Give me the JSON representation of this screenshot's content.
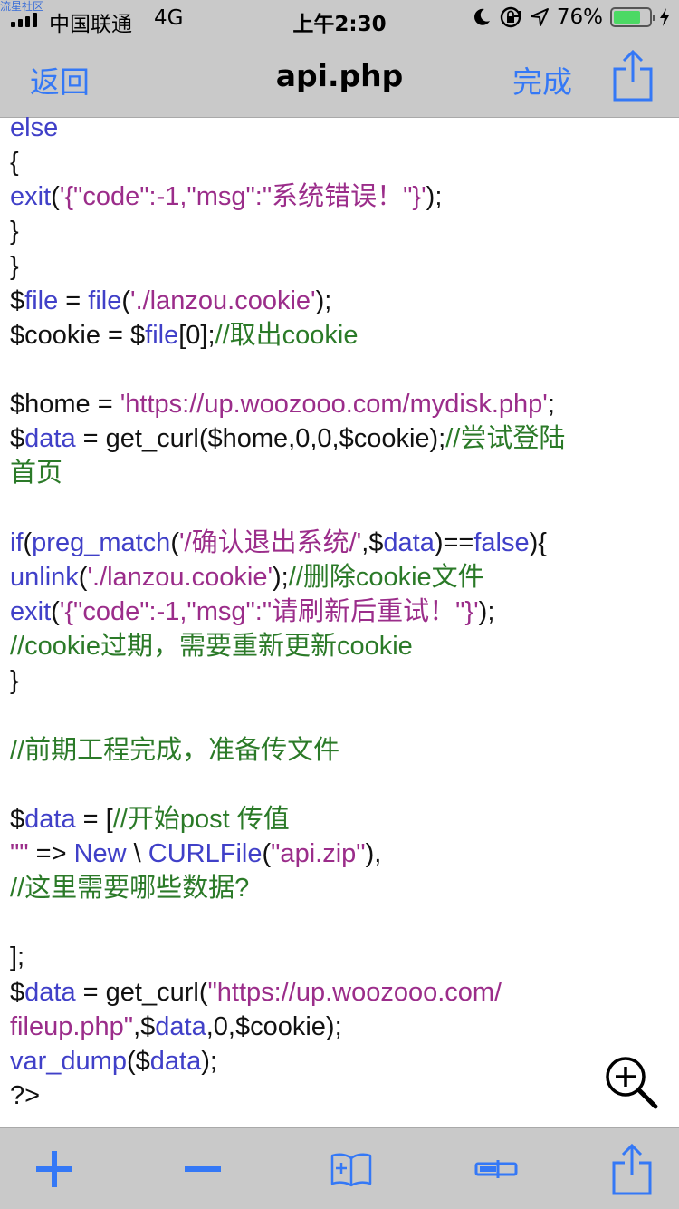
{
  "status_bar": {
    "watermark": "流星社区",
    "carrier": "中国联通",
    "network": "4G",
    "time": "上午2:30",
    "battery_percent": "76%",
    "battery_level": 0.76,
    "icons": [
      "moon-icon",
      "orientation-lock-icon",
      "location-arrow-icon",
      "battery-icon",
      "charging-bolt-icon"
    ]
  },
  "nav": {
    "back_label": "返回",
    "title": "api.php",
    "done_label": "完成",
    "share_icon": "share-icon"
  },
  "colors": {
    "keyword": "#4040c8",
    "string": "#9b2d8a",
    "comment": "#2b7a28",
    "accent": "#3478f6",
    "bar_bg": "#c9c9c9"
  },
  "code_lines": [
    [
      {
        "t": "else",
        "c": "kw"
      }
    ],
    [
      {
        "t": "{",
        "c": "pl"
      }
    ],
    [
      {
        "t": "exit",
        "c": "kw"
      },
      {
        "t": "(",
        "c": "pl"
      },
      {
        "t": "'{\"code\":-1,\"msg\":\"系统错误！\"}'",
        "c": "str"
      },
      {
        "t": ");",
        "c": "pl"
      }
    ],
    [
      {
        "t": "}",
        "c": "pl"
      }
    ],
    [
      {
        "t": "}",
        "c": "pl"
      }
    ],
    [
      {
        "t": "$",
        "c": "pl"
      },
      {
        "t": "file",
        "c": "kw"
      },
      {
        "t": " = ",
        "c": "pl"
      },
      {
        "t": "file",
        "c": "kw"
      },
      {
        "t": "(",
        "c": "pl"
      },
      {
        "t": "'./lanzou.cookie'",
        "c": "str"
      },
      {
        "t": ");",
        "c": "pl"
      }
    ],
    [
      {
        "t": "$cookie = $",
        "c": "pl"
      },
      {
        "t": "file",
        "c": "kw"
      },
      {
        "t": "[0];",
        "c": "pl"
      },
      {
        "t": "//取出cookie",
        "c": "cmt"
      }
    ],
    [],
    [
      {
        "t": "$home = ",
        "c": "pl"
      },
      {
        "t": "'https://up.woozooo.com/mydisk.php'",
        "c": "str"
      },
      {
        "t": ";",
        "c": "pl"
      }
    ],
    [
      {
        "t": "$",
        "c": "pl"
      },
      {
        "t": "data",
        "c": "kw"
      },
      {
        "t": " = get_curl($home,0,0,$cookie);",
        "c": "pl"
      },
      {
        "t": "//尝试登陆",
        "c": "cmt"
      }
    ],
    [
      {
        "t": "首页",
        "c": "cmt"
      }
    ],
    [],
    [
      {
        "t": "if",
        "c": "kw"
      },
      {
        "t": "(",
        "c": "pl"
      },
      {
        "t": "preg_match",
        "c": "kw"
      },
      {
        "t": "(",
        "c": "pl"
      },
      {
        "t": "'/确认退出系统/'",
        "c": "str"
      },
      {
        "t": ",$",
        "c": "pl"
      },
      {
        "t": "data",
        "c": "kw"
      },
      {
        "t": ")==",
        "c": "pl"
      },
      {
        "t": "false",
        "c": "kw"
      },
      {
        "t": "){",
        "c": "pl"
      }
    ],
    [
      {
        "t": "unlink",
        "c": "kw"
      },
      {
        "t": "(",
        "c": "pl"
      },
      {
        "t": "'./lanzou.cookie'",
        "c": "str"
      },
      {
        "t": ");",
        "c": "pl"
      },
      {
        "t": "//删除cookie文件",
        "c": "cmt"
      }
    ],
    [
      {
        "t": "exit",
        "c": "kw"
      },
      {
        "t": "(",
        "c": "pl"
      },
      {
        "t": "'{\"code\":-1,\"msg\":\"请刷新后重试！\"}'",
        "c": "str"
      },
      {
        "t": ");",
        "c": "pl"
      }
    ],
    [
      {
        "t": "//cookie过期，需要重新更新cookie",
        "c": "cmt"
      }
    ],
    [
      {
        "t": "}",
        "c": "pl"
      }
    ],
    [],
    [
      {
        "t": "//前期工程完成，准备传文件",
        "c": "cmt"
      }
    ],
    [],
    [
      {
        "t": "$",
        "c": "pl"
      },
      {
        "t": "data",
        "c": "kw"
      },
      {
        "t": " = [",
        "c": "pl"
      },
      {
        "t": "//开始post 传值",
        "c": "cmt"
      }
    ],
    [
      {
        "t": "\"\"",
        "c": "str"
      },
      {
        "t": " => ",
        "c": "pl"
      },
      {
        "t": "New",
        "c": "kw"
      },
      {
        "t": " \\ ",
        "c": "pl"
      },
      {
        "t": "CURLFile",
        "c": "kw"
      },
      {
        "t": "(",
        "c": "pl"
      },
      {
        "t": "\"api.zip\"",
        "c": "str"
      },
      {
        "t": "),",
        "c": "pl"
      }
    ],
    [
      {
        "t": "//这里需要哪些数据?",
        "c": "cmt"
      }
    ],
    [],
    [
      {
        "t": "];",
        "c": "pl"
      }
    ],
    [
      {
        "t": "$",
        "c": "pl"
      },
      {
        "t": "data",
        "c": "kw"
      },
      {
        "t": " = get_curl(",
        "c": "pl"
      },
      {
        "t": "\"https://up.woozooo.com/",
        "c": "str"
      }
    ],
    [
      {
        "t": "fileup.php\"",
        "c": "str"
      },
      {
        "t": ",$",
        "c": "pl"
      },
      {
        "t": "data",
        "c": "kw"
      },
      {
        "t": ",0,$cookie);",
        "c": "pl"
      }
    ],
    [
      {
        "t": "var_dump",
        "c": "kw"
      },
      {
        "t": "($",
        "c": "pl"
      },
      {
        "t": "data",
        "c": "kw"
      },
      {
        "t": ");",
        "c": "pl"
      }
    ],
    [
      {
        "t": "?>",
        "c": "pl"
      }
    ]
  ],
  "editor": {
    "zoom_icon": "zoom-in-icon"
  },
  "toolbar": {
    "icons": [
      "plus-icon",
      "minus-icon",
      "book-add-icon",
      "cursor-icon",
      "share-icon"
    ]
  }
}
